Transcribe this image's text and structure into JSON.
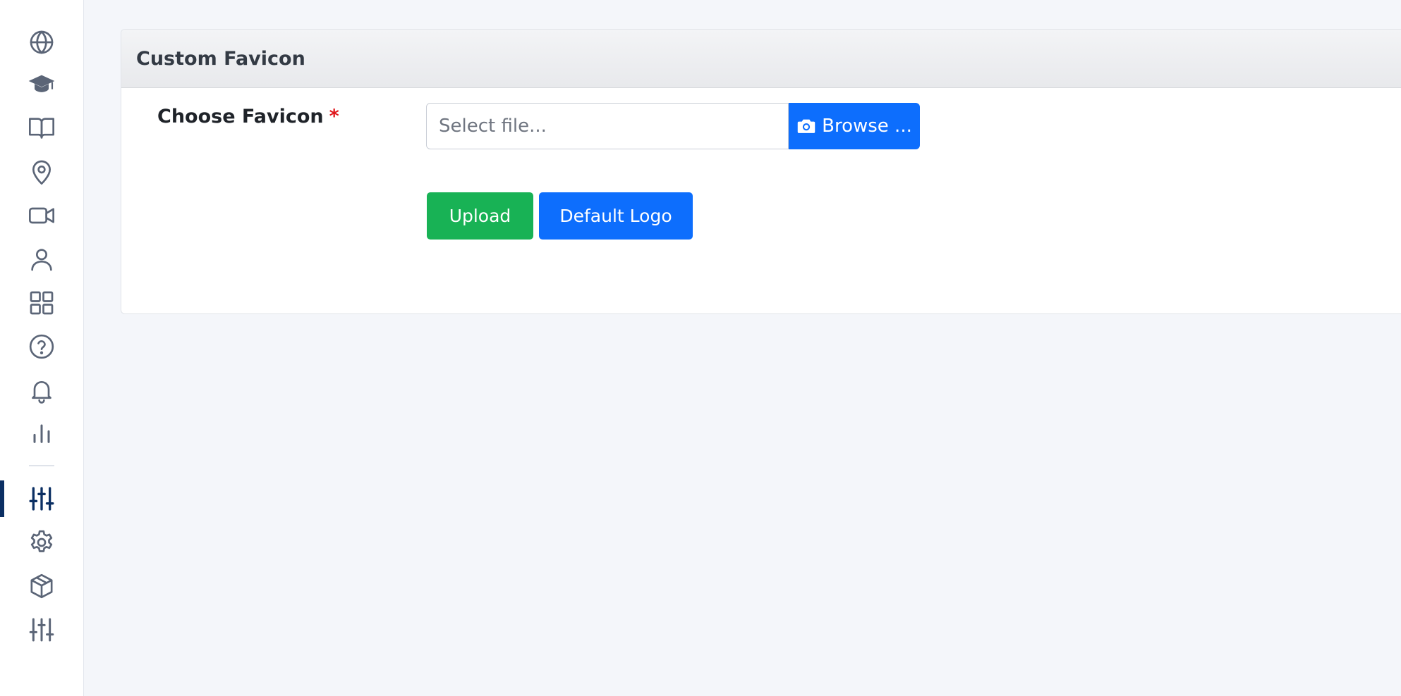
{
  "sidebar": {
    "items": [
      {
        "icon": "globe-icon"
      },
      {
        "icon": "graduation-cap-icon"
      },
      {
        "icon": "book-icon"
      },
      {
        "icon": "map-pin-icon"
      },
      {
        "icon": "video-icon"
      },
      {
        "icon": "user-icon"
      },
      {
        "icon": "grid-icon"
      },
      {
        "icon": "help-circle-icon"
      },
      {
        "icon": "bell-icon"
      },
      {
        "icon": "bar-chart-icon"
      },
      {
        "icon": "sliders-icon",
        "active": true
      },
      {
        "icon": "gear-icon"
      },
      {
        "icon": "box-icon"
      },
      {
        "icon": "sliders-icon"
      }
    ]
  },
  "card": {
    "title": "Custom Favicon",
    "field_label": "Choose Favicon",
    "required_marker": "*",
    "file_placeholder": "Select file...",
    "browse_label": "Browse ...",
    "upload_label": "Upload",
    "default_label": "Default Logo"
  },
  "colors": {
    "primary": "#0d6efd",
    "success": "#18b255",
    "required": "#e0171c",
    "active_indicator": "#0b2f63",
    "icon": "#5b6577"
  }
}
